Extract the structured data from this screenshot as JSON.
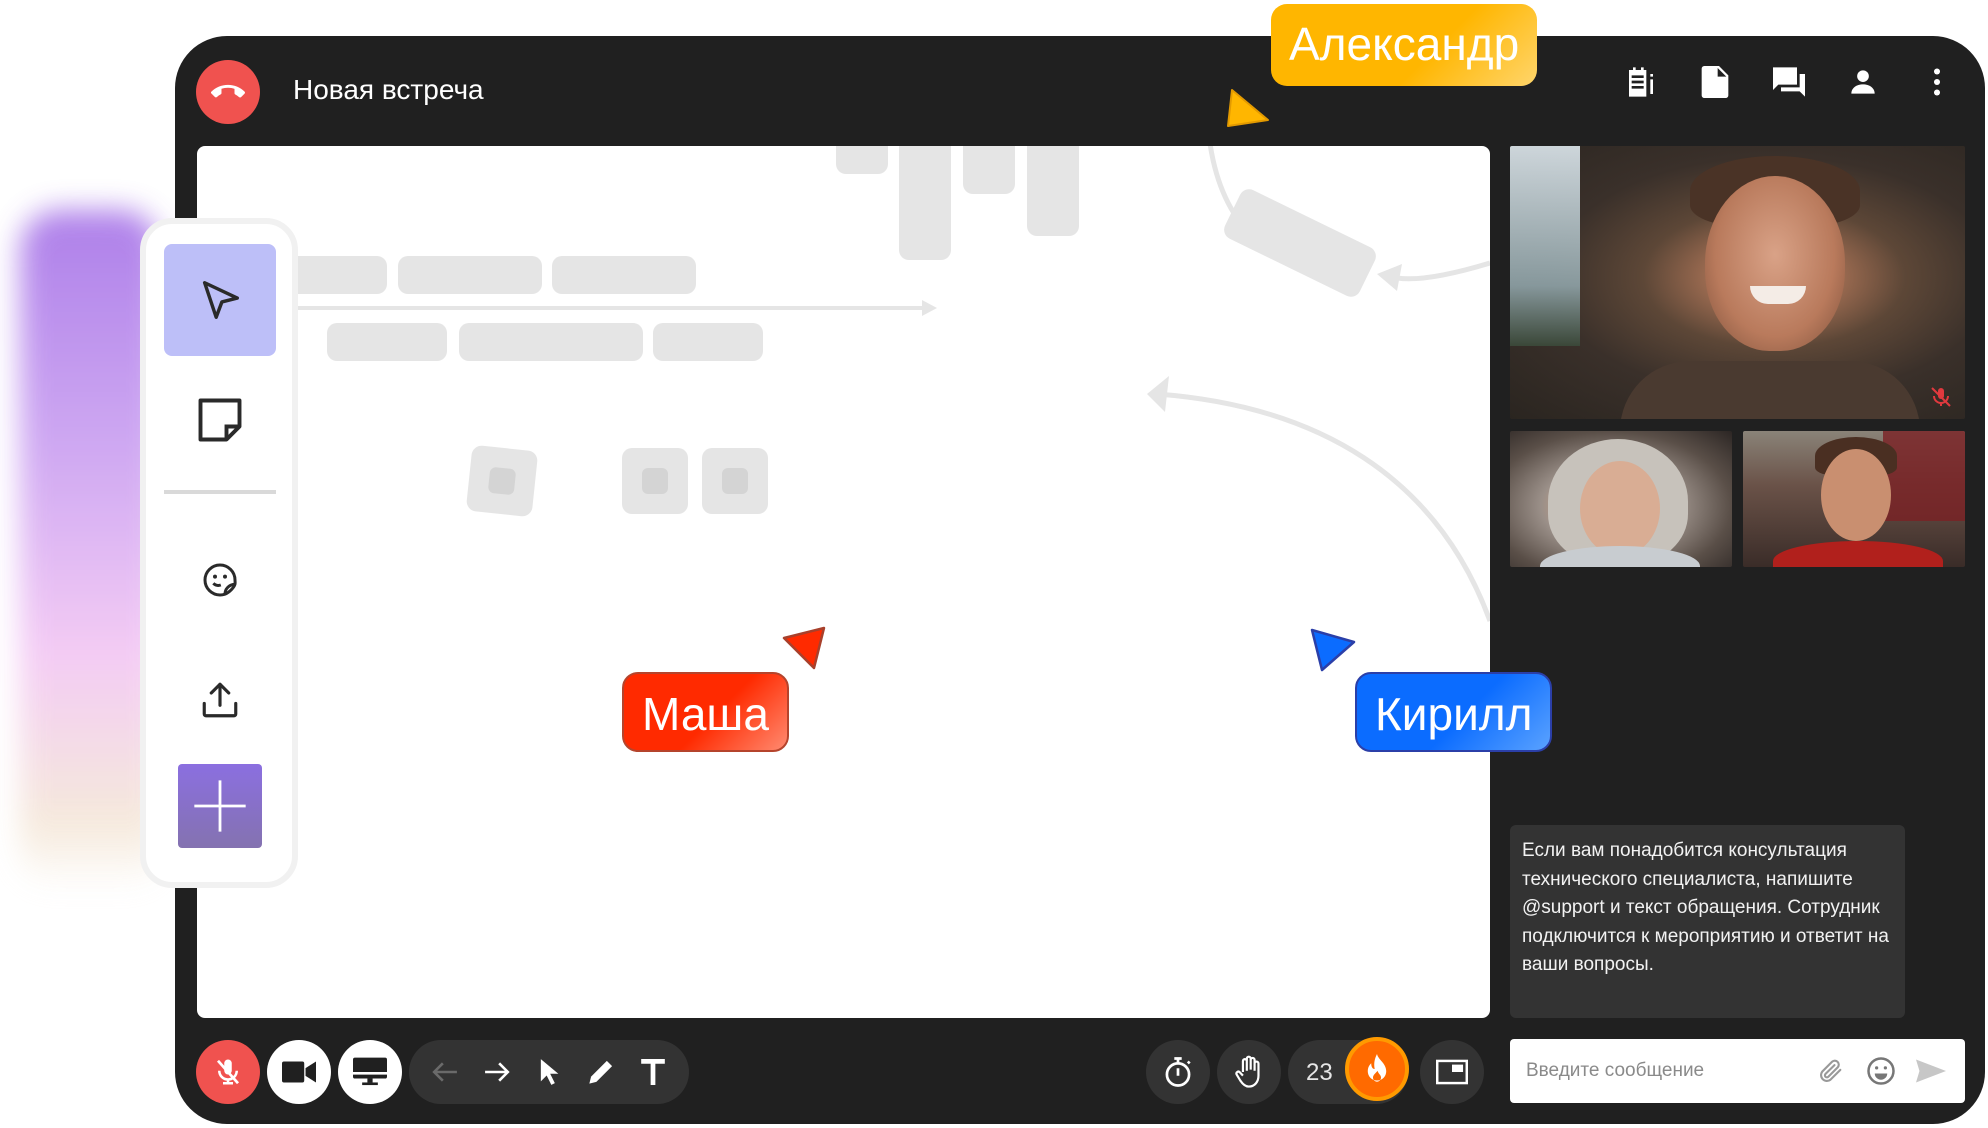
{
  "meeting": {
    "title": "Новая встреча"
  },
  "topbar": {
    "icons": [
      {
        "name": "notes-icon",
        "label": "Заметки"
      },
      {
        "name": "document-icon",
        "label": "Документ"
      },
      {
        "name": "chat-icon",
        "label": "Чат"
      },
      {
        "name": "participants-icon",
        "label": "Участники"
      },
      {
        "name": "more-icon",
        "label": "Ещё"
      }
    ]
  },
  "toolbox": {
    "tools": [
      {
        "name": "select-tool",
        "active": true
      },
      {
        "name": "sticky-note-tool",
        "active": false
      },
      {
        "name": "sticker-tool",
        "active": false
      },
      {
        "name": "upload-tool",
        "active": false
      },
      {
        "name": "add-tool",
        "active": false
      }
    ]
  },
  "cursors": [
    {
      "name": "Александр",
      "color": "#ffb600"
    },
    {
      "name": "Маша",
      "color": "#ff2a00"
    },
    {
      "name": "Кирилл",
      "color": "#0b6cff"
    }
  ],
  "videos": [
    {
      "role": "main-speaker",
      "muted": true
    },
    {
      "role": "participant",
      "muted": false
    },
    {
      "role": "participant",
      "muted": false
    }
  ],
  "chat": {
    "messages": [
      {
        "text": "Если вам понадобится консультация технического специалиста, напишите @support и текст обращения. Сотрудник подключится к мероприятию и ответит на ваши вопросы."
      }
    ],
    "input_placeholder": "Введите сообщение",
    "input_value": ""
  },
  "controls": {
    "mic_muted": true,
    "camera": "on",
    "screen_share": "off",
    "draw_tools": [
      "undo-icon",
      "redo-icon",
      "pointer-icon",
      "pencil-icon",
      "text-icon"
    ],
    "reaction_count": "23"
  },
  "colors": {
    "end_call": "#f0524f",
    "window_bg": "#202020",
    "pill_bg": "#333333",
    "active_tool": "#bdbff8",
    "reaction": "#ff6a00"
  }
}
